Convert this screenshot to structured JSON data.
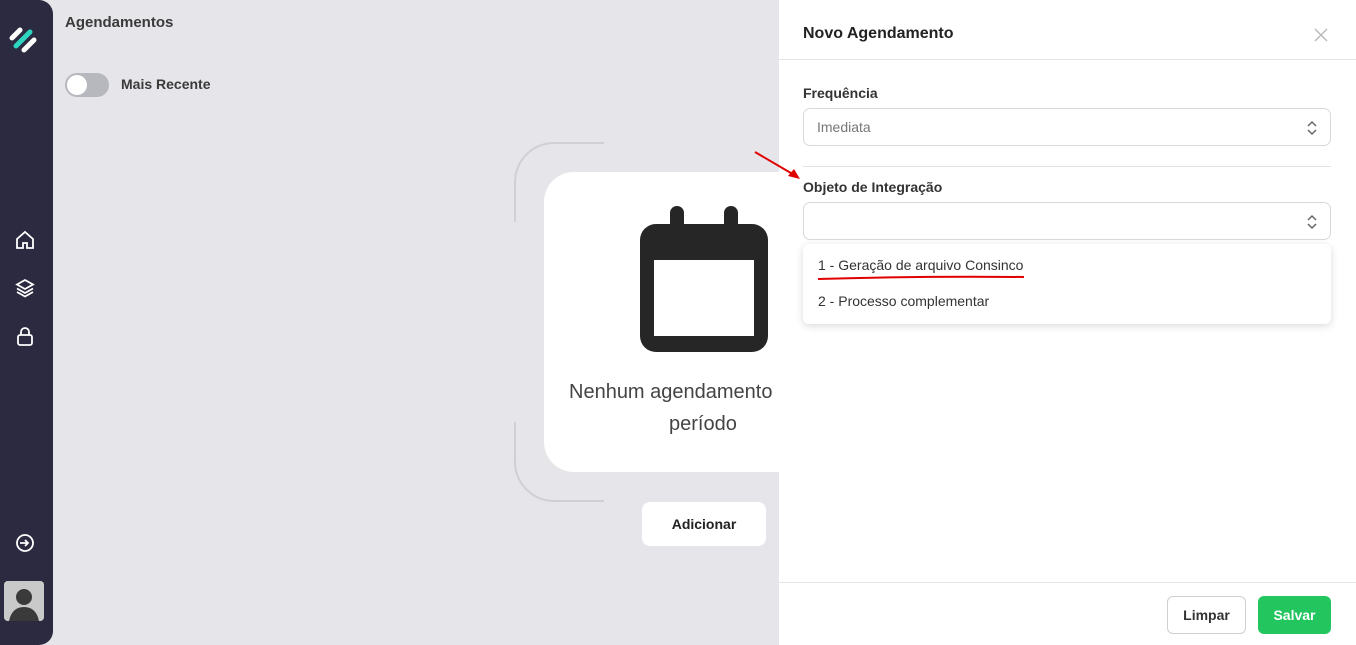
{
  "main": {
    "title": "Agendamentos",
    "toggle_label": "Mais Recente",
    "toggle_on": false,
    "empty_line1": "Nenhum agendamento",
    "empty_line2": "período",
    "add_label": "Adicionar"
  },
  "sidebar": {
    "items": [
      {
        "icon": "home-icon"
      },
      {
        "icon": "layers-icon"
      },
      {
        "icon": "lock-icon"
      },
      {
        "icon": "logout-icon"
      }
    ]
  },
  "drawer": {
    "title": "Novo Agendamento",
    "frequency_label": "Frequência",
    "frequency_value": "Imediata",
    "object_label": "Objeto de Integração",
    "object_value": "",
    "options": [
      "1 - Geração de arquivo Consinco",
      "2 - Processo complementar"
    ],
    "clear_label": "Limpar",
    "save_label": "Salvar"
  },
  "colors": {
    "sidebar": "#2b2a40",
    "accent": "#2dd4bf",
    "save": "#22c55e",
    "annotation": "#e00000"
  }
}
